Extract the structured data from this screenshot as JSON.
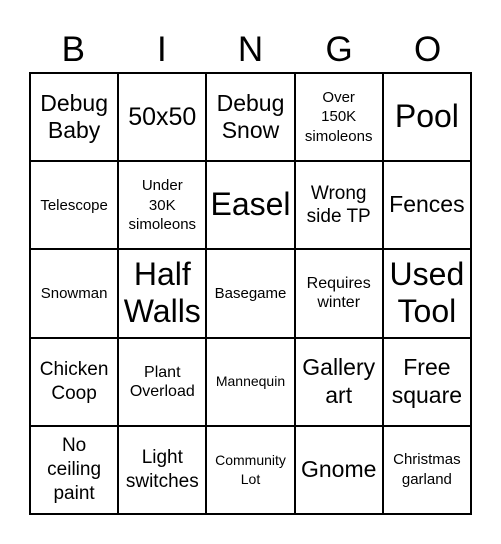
{
  "header": {
    "letters": [
      "B",
      "I",
      "N",
      "G",
      "O"
    ]
  },
  "board": {
    "cells": [
      {
        "text": "Debug\nBaby"
      },
      {
        "text": "50x50"
      },
      {
        "text": "Debug\nSnow"
      },
      {
        "text": "Over\n150K\nsimoleons"
      },
      {
        "text": "Pool"
      },
      {
        "text": "Telescope"
      },
      {
        "text": "Under\n30K\nsimoleons"
      },
      {
        "text": "Easel"
      },
      {
        "text": "Wrong\nside TP"
      },
      {
        "text": "Fences"
      },
      {
        "text": "Snowman"
      },
      {
        "text": "Half\nWalls"
      },
      {
        "text": "Basegame"
      },
      {
        "text": "Requires\nwinter"
      },
      {
        "text": "Used\nTool"
      },
      {
        "text": "Chicken\nCoop"
      },
      {
        "text": "Plant\nOverload"
      },
      {
        "text": "Mannequin"
      },
      {
        "text": "Gallery\nart"
      },
      {
        "text": "Free\nsquare"
      },
      {
        "text": "No\nceiling\npaint"
      },
      {
        "text": "Light\nswitches"
      },
      {
        "text": "Community\nLot"
      },
      {
        "text": "Gnome"
      },
      {
        "text": "Christmas\ngarland"
      }
    ]
  }
}
